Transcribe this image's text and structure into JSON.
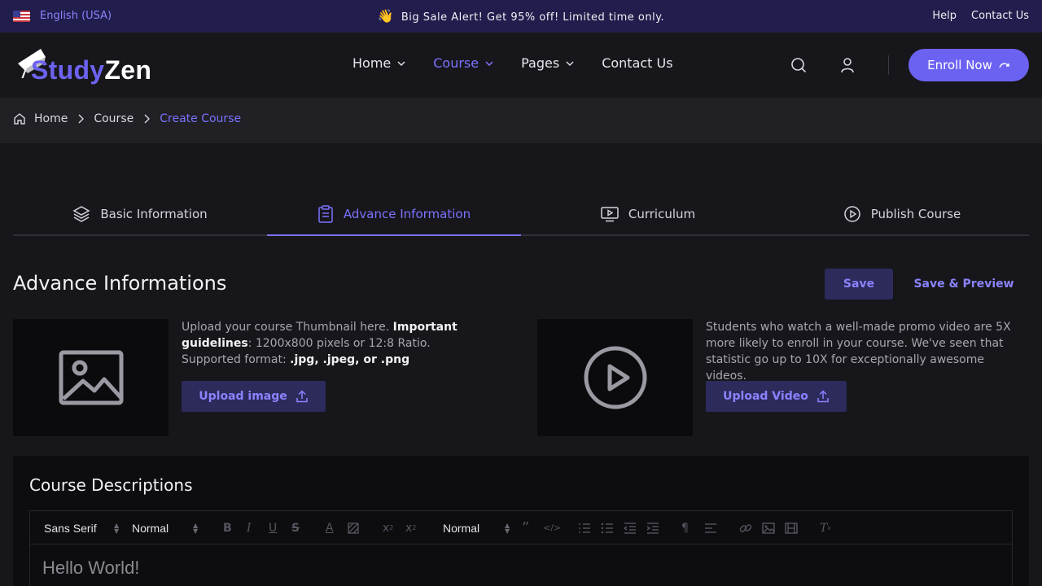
{
  "topbar": {
    "language": "English (USA)",
    "promo_emoji": "👋",
    "promo_text": "Big Sale Alert! Get 95% off! Limited time only.",
    "links": [
      "Help",
      "Contact Us"
    ]
  },
  "header": {
    "logo_part1": "Study",
    "logo_part2": "Zen",
    "nav": [
      {
        "label": "Home",
        "has_dropdown": true
      },
      {
        "label": "Course",
        "has_dropdown": true,
        "active": true
      },
      {
        "label": "Pages",
        "has_dropdown": true
      },
      {
        "label": "Contact Us",
        "has_dropdown": false
      }
    ],
    "enroll_label": "Enroll Now"
  },
  "breadcrumb": [
    "Home",
    "Course",
    "Create Course"
  ],
  "steps": [
    {
      "label": "Basic Information",
      "icon": "layers-icon"
    },
    {
      "label": "Advance Information",
      "icon": "clipboard-icon",
      "active": true
    },
    {
      "label": "Curriculum",
      "icon": "monitor-play-icon"
    },
    {
      "label": "Publish Course",
      "icon": "play-circle-icon"
    }
  ],
  "section": {
    "title": "Advance Informations",
    "save_label": "Save",
    "preview_label": "Save & Preview"
  },
  "thumbnail": {
    "desc_1": "Upload your course Thumbnail here. ",
    "desc_bold_1": "Important guidelines",
    "desc_2": ": 1200x800 pixels or 12:8 Ratio. Supported format: ",
    "desc_bold_2": ".jpg, .jpeg, or .png",
    "button": "Upload image"
  },
  "video": {
    "desc": "Students who watch a well-made promo video are 5X more likely to enroll in your course. We've seen that statistic go up to 10X for exceptionally awesome videos.",
    "button": "Upload Video"
  },
  "description": {
    "title": "Course Descriptions",
    "font_select": "Sans Serif",
    "size_select": "Normal",
    "header_select": "Normal",
    "content": "Hello World!"
  },
  "colors": {
    "accent": "#6c62f2",
    "topbar_bg": "#211d4c",
    "page_bg": "#17171b"
  }
}
